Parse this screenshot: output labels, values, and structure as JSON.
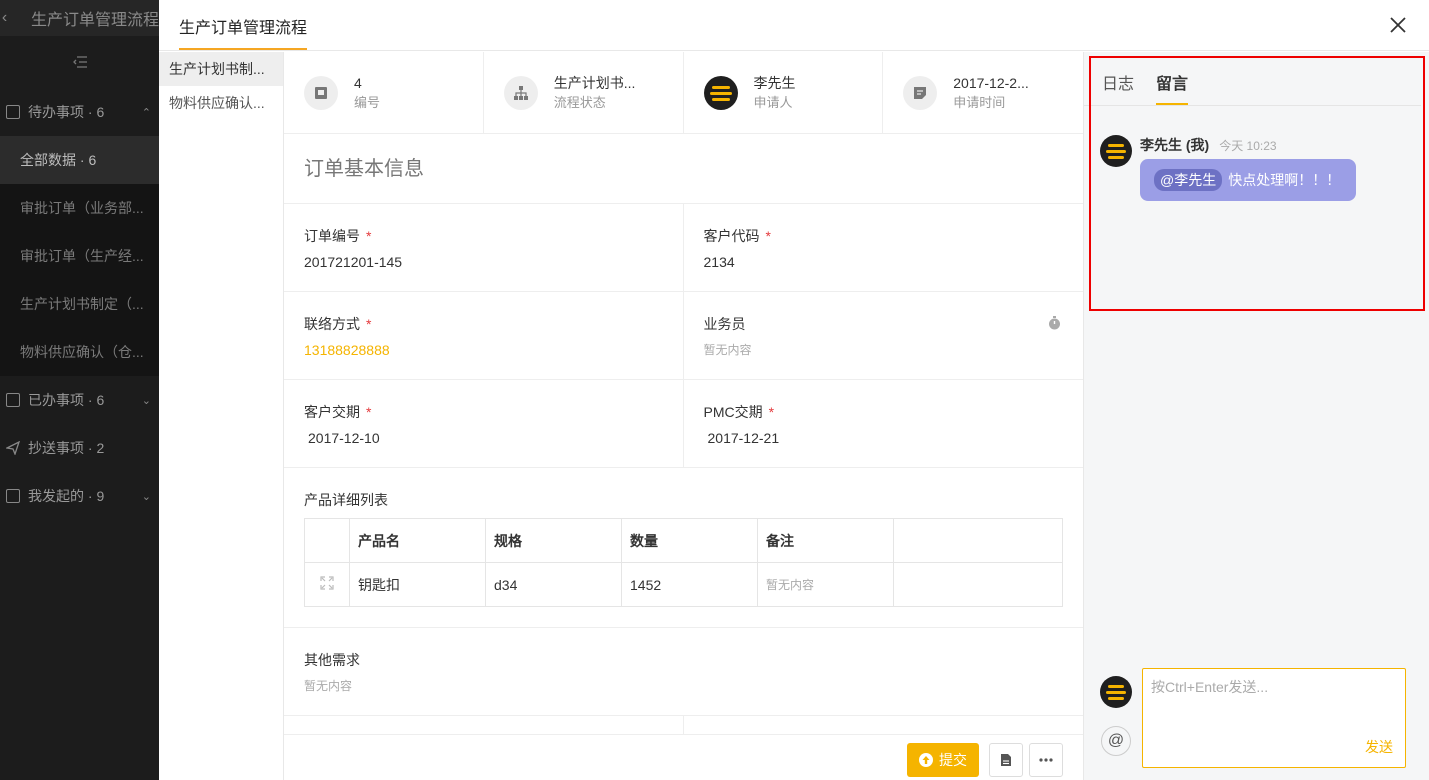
{
  "background": {
    "title": "生产订单管理流程",
    "groups": [
      {
        "label": "待办事项 · 6"
      },
      {
        "label": "已办事项 · 6"
      },
      {
        "label": "抄送事项 · 2"
      },
      {
        "label": "我发起的 · 9"
      }
    ],
    "sub_items": [
      {
        "label": "全部数据 · 6"
      },
      {
        "label": "审批订单（业务部..."
      },
      {
        "label": "审批订单（生产经..."
      },
      {
        "label": "生产计划书制定（..."
      },
      {
        "label": "物料供应确认（仓..."
      }
    ]
  },
  "modal": {
    "title": "生产订单管理流程",
    "nav": [
      {
        "label": "生产计划书制..."
      },
      {
        "label": "物料供应确认..."
      }
    ],
    "summary": [
      {
        "value": "4",
        "label": "编号",
        "icon": "id-badge-icon"
      },
      {
        "value": "生产计划书...",
        "label": "流程状态",
        "icon": "flow-tree-icon"
      },
      {
        "value": "李先生",
        "label": "申请人",
        "icon": "user-avatar"
      },
      {
        "value": "2017-12-2...",
        "label": "申请时间",
        "icon": "note-icon"
      }
    ],
    "section_title": "订单基本信息",
    "fields": {
      "order_no": {
        "label": "订单编号",
        "value": "201721201-145"
      },
      "customer_code": {
        "label": "客户代码",
        "value": "2134"
      },
      "contact": {
        "label": "联络方式",
        "value": "13188828888"
      },
      "salesman": {
        "label": "业务员",
        "value": "暂无内容"
      },
      "customer_date": {
        "label": "客户交期",
        "value": "2017-12-10"
      },
      "pmc_date": {
        "label": "PMC交期",
        "value": "2017-12-21"
      }
    },
    "required_mark": "*",
    "product_table": {
      "title": "产品详细列表",
      "headers": [
        "产品名",
        "规格",
        "数量",
        "备注"
      ],
      "rows": [
        {
          "name": "钥匙扣",
          "spec": "d34",
          "qty": "1452",
          "note": "暂无内容"
        }
      ]
    },
    "other": {
      "label": "其他需求",
      "value": "暂无内容"
    },
    "footer": {
      "submit_label": "提交"
    }
  },
  "comments": {
    "tabs": [
      {
        "label": "日志"
      },
      {
        "label": "留言"
      }
    ],
    "active_tab": "留言",
    "messages": [
      {
        "name": "李先生 (我)",
        "time": "今天 10:23",
        "mention": "@李先生",
        "text": "快点处理啊！！！"
      }
    ],
    "input_placeholder": "按Ctrl+Enter发送...",
    "send_label": "发送",
    "at_label": "@"
  },
  "colors": {
    "accent": "#f5b400",
    "bubble": "#9b9ee6",
    "highlight": "#e00000"
  }
}
